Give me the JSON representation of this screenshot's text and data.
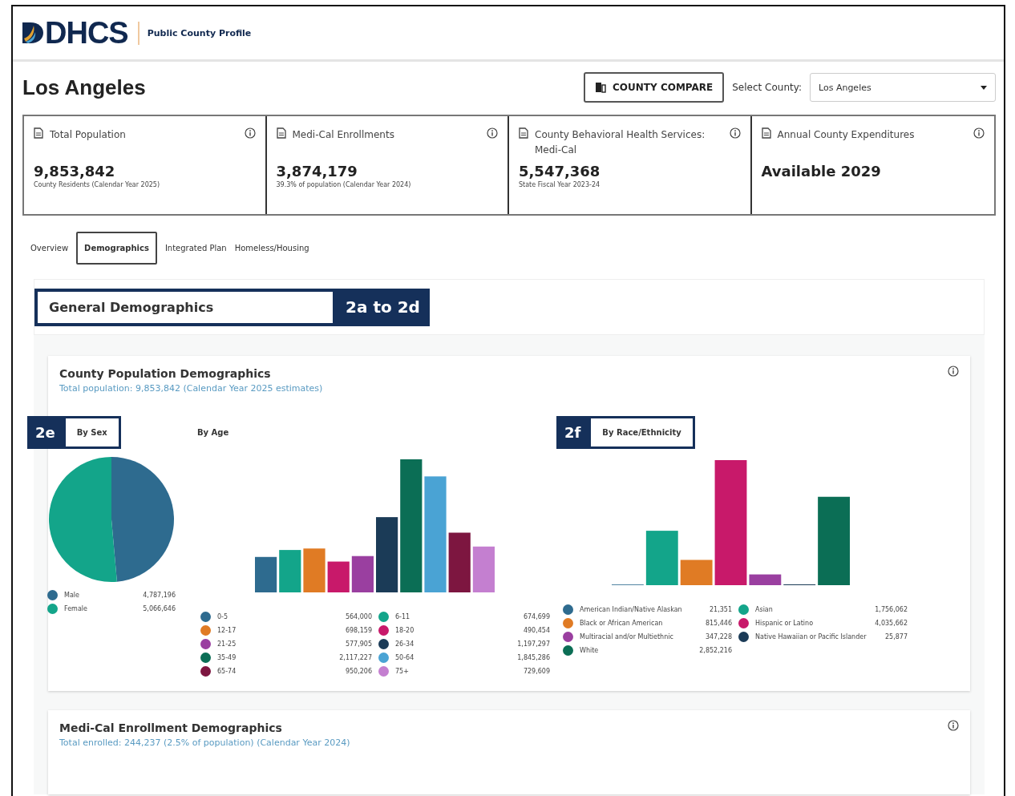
{
  "header": {
    "logo": "DHCS",
    "subtitle": "Public County Profile"
  },
  "page": {
    "title": "Los Angeles",
    "compare_button": "COUNTY COMPARE",
    "county_label": "Select County:",
    "county_value": "Los Angeles"
  },
  "kpis": [
    {
      "title": "Total Population",
      "value": "9,853,842",
      "note": "County Residents (Calendar Year 2025)"
    },
    {
      "title": "Medi-Cal Enrollments",
      "value": "3,874,179",
      "note": "39.3% of population (Calendar Year 2024)"
    },
    {
      "title": "County Behavioral Health Services: Medi-Cal",
      "value": "5,547,368",
      "note": "State Fiscal Year 2023-24"
    },
    {
      "title": "Annual County Expenditures",
      "value": "Available 2029"
    }
  ],
  "tabs": [
    {
      "label": "Overview",
      "selected": false
    },
    {
      "label": "Demographics",
      "selected": true
    },
    {
      "label": "Integrated Plan",
      "selected": false
    },
    {
      "label": "Homeless/Housing",
      "selected": false
    }
  ],
  "section": {
    "title": "General Demographics",
    "callout": "2a to 2d"
  },
  "population_card": {
    "title": "County Population Demographics",
    "subtitle": "Total population: 9,853,842 (Calendar Year 2025 estimates)",
    "by_sex": {
      "label": "By Sex",
      "callout": "2e",
      "legend": [
        {
          "name": "Male",
          "reading": "4,787,196",
          "color": "#2e6b8f"
        },
        {
          "name": "Female",
          "reading": "5,066,646",
          "color": "#13a58a"
        }
      ]
    },
    "by_age": {
      "label": "By Age",
      "legend": [
        {
          "name": "0-5",
          "reading": "564,000",
          "color": "#2e6b8f"
        },
        {
          "name": "6-11",
          "reading": "674,699",
          "color": "#13a58a"
        },
        {
          "name": "12-17",
          "reading": "698,159",
          "color": "#e07b24"
        },
        {
          "name": "18-20",
          "reading": "490,454",
          "color": "#c8196a"
        },
        {
          "name": "21-25",
          "reading": "577,905",
          "color": "#9a3fa0"
        },
        {
          "name": "26-34",
          "reading": "1,197,297",
          "color": "#1b3b57"
        },
        {
          "name": "35-49",
          "reading": "2,117,227",
          "color": "#0b6e55"
        },
        {
          "name": "50-64",
          "reading": "1,845,286",
          "color": "#4aa3d4"
        },
        {
          "name": "65-74",
          "reading": "950,206",
          "color": "#7d1640"
        },
        {
          "name": "75+",
          "reading": "729,609",
          "color": "#c47fd0"
        }
      ]
    },
    "by_race": {
      "label": "By Race/Ethnicity",
      "callout": "2f",
      "legend": [
        {
          "name": "American Indian/Native Alaskan",
          "reading": "21,351",
          "color": "#2e6b8f"
        },
        {
          "name": "Asian",
          "reading": "1,756,062",
          "color": "#13a58a"
        },
        {
          "name": "Black or African American",
          "reading": "815,446",
          "color": "#e07b24"
        },
        {
          "name": "Hispanic or Latino",
          "reading": "4,035,662",
          "color": "#c8196a"
        },
        {
          "name": "Multiracial and/or Multiethnic",
          "reading": "347,228",
          "color": "#9a3fa0"
        },
        {
          "name": "Native Hawaiian or Pacific Islander",
          "reading": "25,877",
          "color": "#1b3b57"
        },
        {
          "name": "White",
          "reading": "2,852,216",
          "color": "#0b6e55"
        }
      ]
    }
  },
  "enrollment_card": {
    "title": "Medi-Cal Enrollment Demographics",
    "subtitle": "Total enrolled: 244,237 (2.5% of population) (Calendar Year 2024)"
  }
}
